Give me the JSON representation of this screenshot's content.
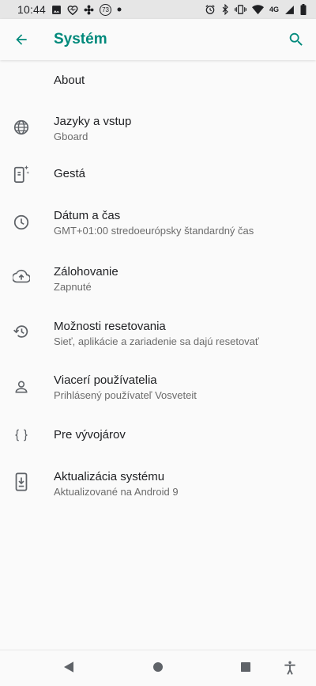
{
  "status_bar": {
    "time": "10:44",
    "badge": "73",
    "network": "4G",
    "left_icons": [
      "image-icon",
      "heart-icon",
      "flower-icon",
      "badge-73-icon",
      "dot-icon"
    ],
    "right_icons": [
      "alarm-icon",
      "bluetooth-icon",
      "vibrate-icon",
      "wifi-icon",
      "signal-icon",
      "battery-icon"
    ]
  },
  "app_bar": {
    "title": "Systém",
    "accent": "#00897b"
  },
  "settings": [
    {
      "label": "About",
      "sub": "",
      "icon": "none"
    },
    {
      "label": "Jazyky a vstup",
      "sub": "Gboard",
      "icon": "globe-icon"
    },
    {
      "label": "Gestá",
      "sub": "",
      "icon": "gesture-phone-icon"
    },
    {
      "label": "Dátum a čas",
      "sub": "GMT+01:00 stredoeurópsky štandardný čas",
      "icon": "clock-icon"
    },
    {
      "label": "Zálohovanie",
      "sub": "Zapnuté",
      "icon": "cloud-upload-icon"
    },
    {
      "label": "Možnosti resetovania",
      "sub": "Sieť, aplikácie a zariadenie sa dajú resetovať",
      "icon": "history-icon"
    },
    {
      "label": "Viacerí používatelia",
      "sub": "Prihlásený používateľ Vosveteit",
      "icon": "person-icon"
    },
    {
      "label": "Pre vývojárov",
      "sub": "",
      "icon": "braces-icon"
    },
    {
      "label": "Aktualizácia systému",
      "sub": "Aktualizované na Android 9",
      "icon": "system-update-icon"
    }
  ],
  "nav_bar": {
    "buttons": [
      "back-icon",
      "home-icon",
      "recents-icon",
      "accessibility-icon"
    ]
  }
}
